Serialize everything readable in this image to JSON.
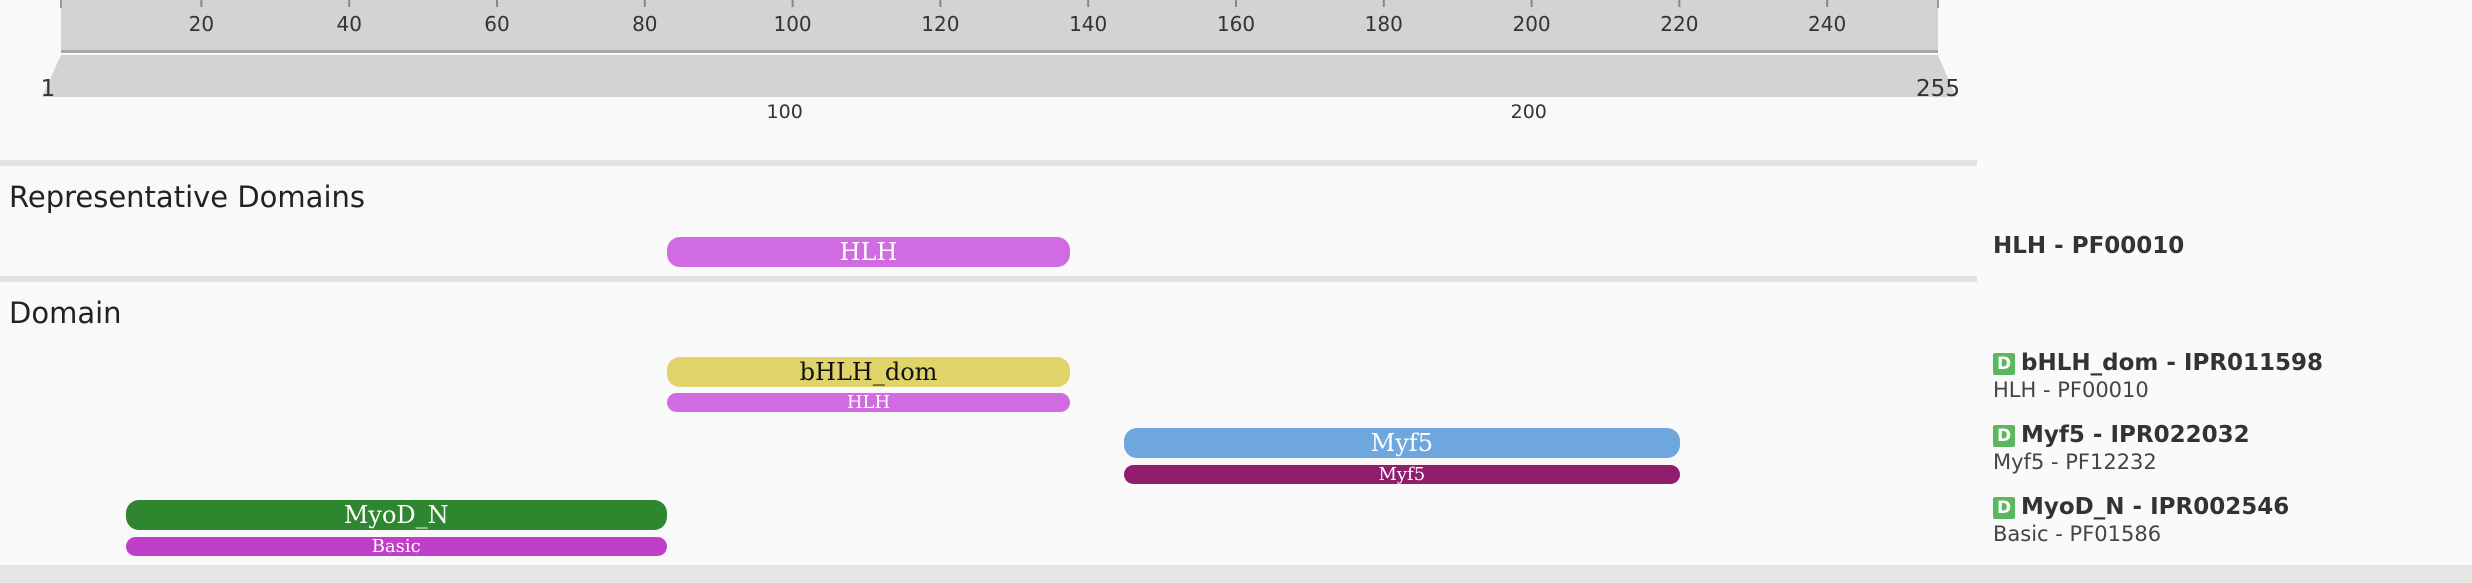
{
  "ruler": {
    "min": 1,
    "max": 255,
    "top_ticks": [
      "20",
      "40",
      "60",
      "80",
      "100",
      "120",
      "140",
      "160",
      "180",
      "200",
      "220",
      "240"
    ],
    "start_label": "1",
    "end_label": "255",
    "bottom_ticks": [
      "100",
      "200"
    ]
  },
  "sections": {
    "representative": "Representative Domains",
    "domain": "Domain"
  },
  "tracks": {
    "hlh_rep": {
      "label": "HLH",
      "start": 83,
      "end": 136,
      "color": "#d16be2"
    },
    "bhlh_dom": {
      "label": "bHLH_dom",
      "start": 83,
      "end": 136,
      "color": "#e0d36a"
    },
    "hlh_sub": {
      "label": "HLH",
      "start": 83,
      "end": 136,
      "color": "#d16be2"
    },
    "myf5": {
      "label": "Myf5",
      "start": 143,
      "end": 216,
      "color": "#6ea7dd"
    },
    "myf5_sub": {
      "label": "Myf5",
      "start": 143,
      "end": 216,
      "color": "#901e6d"
    },
    "myod_n": {
      "label": "MyoD_N",
      "start": 12,
      "end": 83,
      "color": "#2e862f"
    },
    "basic_sub": {
      "label": "Basic",
      "start": 12,
      "end": 83,
      "color": "#bf3fc9"
    }
  },
  "legend": {
    "hlh": {
      "title": "HLH - PF00010"
    },
    "bhlh": {
      "badge": "D",
      "title": "bHLH_dom - IPR011598",
      "sub": "HLH - PF00010"
    },
    "myf5": {
      "badge": "D",
      "title": "Myf5 - IPR022032",
      "sub": "Myf5 - PF12232"
    },
    "myod": {
      "badge": "D",
      "title": "MyoD_N - IPR002546",
      "sub": "Basic - PF01586"
    }
  }
}
